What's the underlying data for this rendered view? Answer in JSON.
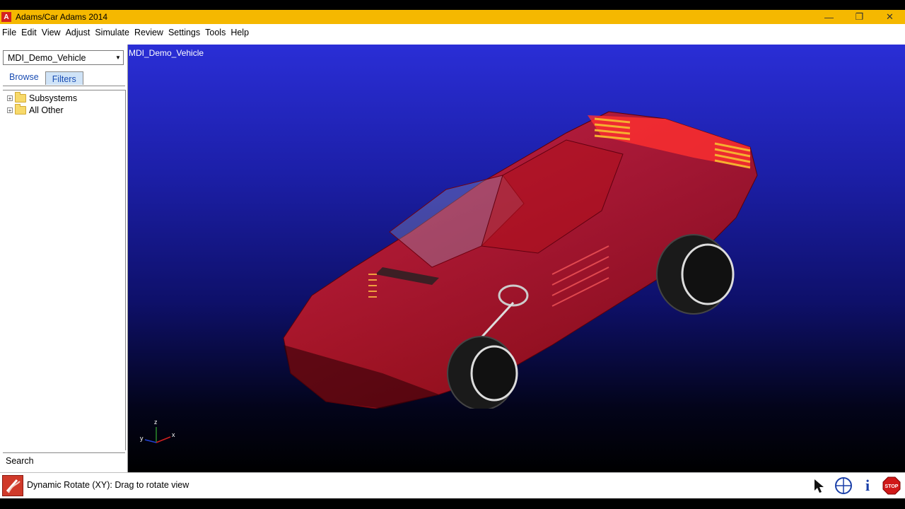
{
  "window": {
    "title": "Adams/Car Adams 2014",
    "app_icon_letter": "A",
    "controls": {
      "minimize": "—",
      "restore": "❐",
      "close": "✕"
    }
  },
  "menu": [
    "File",
    "Edit",
    "View",
    "Adjust",
    "Simulate",
    "Review",
    "Settings",
    "Tools",
    "Help"
  ],
  "left_panel": {
    "model_selector": "MDI_Demo_Vehicle",
    "tabs": [
      {
        "label": "Browse",
        "active": false
      },
      {
        "label": "Filters",
        "active": true
      }
    ],
    "tree": [
      {
        "label": "Subsystems",
        "icon": "folder-icon"
      },
      {
        "label": "All Other",
        "icon": "folder-icon"
      }
    ],
    "search_label": "Search"
  },
  "viewport": {
    "title": "MDI_Demo_Vehicle",
    "triad": {
      "z": "z",
      "x": "x",
      "y": "y"
    },
    "colors": {
      "background_top": "#2a2ed6",
      "background_bottom": "#000000",
      "vehicle": "#c0141c"
    }
  },
  "status_bar": {
    "message": "Dynamic Rotate (XY): Drag to rotate view",
    "tools": [
      "select-arrow-icon",
      "compass-icon",
      "info-icon",
      "stop-icon"
    ],
    "stop_label": "STOP",
    "info_label": "i"
  },
  "theme": {
    "titlebar": "#f5b800",
    "accent": "#cfe3f7"
  }
}
